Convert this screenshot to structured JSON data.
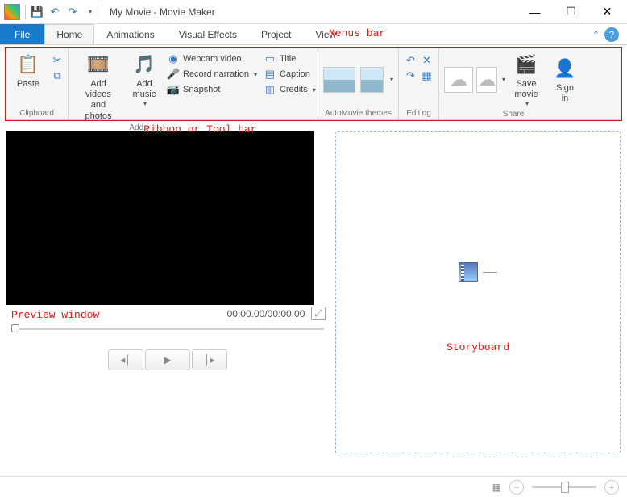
{
  "title": "My Movie - Movie Maker",
  "menus": {
    "file": "File",
    "home": "Home",
    "anim": "Animations",
    "vfx": "Visual Effects",
    "project": "Project",
    "view": "View"
  },
  "annotations": {
    "menus": "Menus bar",
    "ribbon": "Ribbon or Tool bar",
    "preview": "Preview window",
    "storyboard": "Storyboard"
  },
  "ribbon": {
    "clipboard": {
      "paste": "Paste",
      "group": "Clipboard"
    },
    "add": {
      "videos": "Add videos\nand photos",
      "music": "Add\nmusic",
      "webcam": "Webcam video",
      "narration": "Record narration",
      "snapshot": "Snapshot",
      "title": "Title",
      "caption": "Caption",
      "credits": "Credits",
      "group": "Add"
    },
    "automovie": {
      "group": "AutoMovie themes"
    },
    "editing": {
      "group": "Editing"
    },
    "share": {
      "save": "Save\nmovie",
      "signin": "Sign\nin",
      "group": "Share"
    }
  },
  "preview": {
    "time": "00:00.00/00:00.00"
  }
}
